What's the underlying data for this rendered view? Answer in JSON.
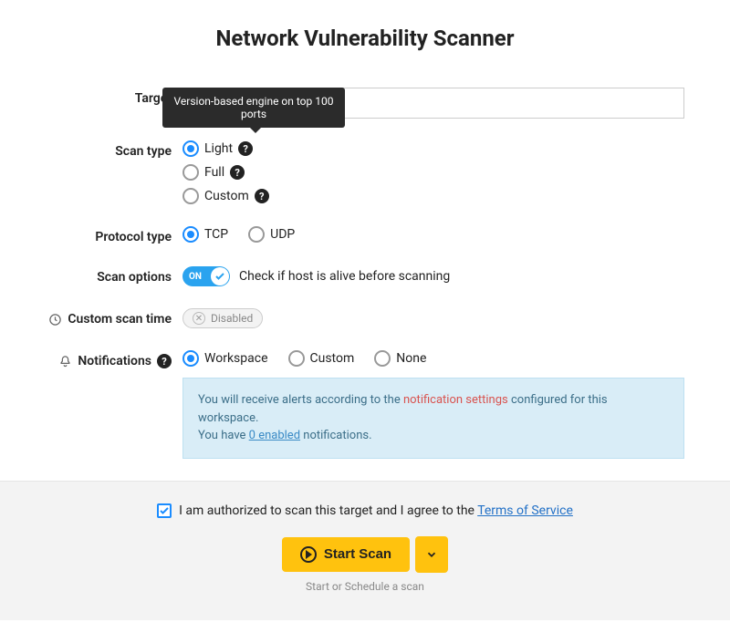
{
  "title": "Network Vulnerability Scanner",
  "fields": {
    "target": {
      "label": "Target",
      "value": ""
    },
    "scan_type": {
      "label": "Scan type",
      "tooltip": "Version-based engine on top 100 ports",
      "options": [
        {
          "label": "Light",
          "checked": true,
          "help": true
        },
        {
          "label": "Full",
          "checked": false,
          "help": true
        },
        {
          "label": "Custom",
          "checked": false,
          "help": true
        }
      ]
    },
    "protocol": {
      "label": "Protocol type",
      "options": [
        {
          "label": "TCP",
          "checked": true
        },
        {
          "label": "UDP",
          "checked": false
        }
      ]
    },
    "scan_options": {
      "label": "Scan options",
      "toggle_state": "ON",
      "toggle_label": "Check if host is alive before scanning"
    },
    "custom_time": {
      "label": "Custom scan time",
      "status": "Disabled"
    },
    "notifications": {
      "label": "Notifications",
      "options": [
        {
          "label": "Workspace",
          "checked": true
        },
        {
          "label": "Custom",
          "checked": false
        },
        {
          "label": "None",
          "checked": false
        }
      ],
      "info": {
        "pre": "You will receive alerts according to the ",
        "link": "notification settings",
        "post": " configured for this workspace.",
        "line2_pre": "You have ",
        "line2_link": "0 enabled",
        "line2_post": " notifications."
      }
    }
  },
  "footer": {
    "consent_pre": "I am authorized to scan this target and I agree to the ",
    "consent_link": "Terms of Service",
    "consent_checked": true,
    "start_label": "Start Scan",
    "hint": "Start or Schedule a scan"
  }
}
